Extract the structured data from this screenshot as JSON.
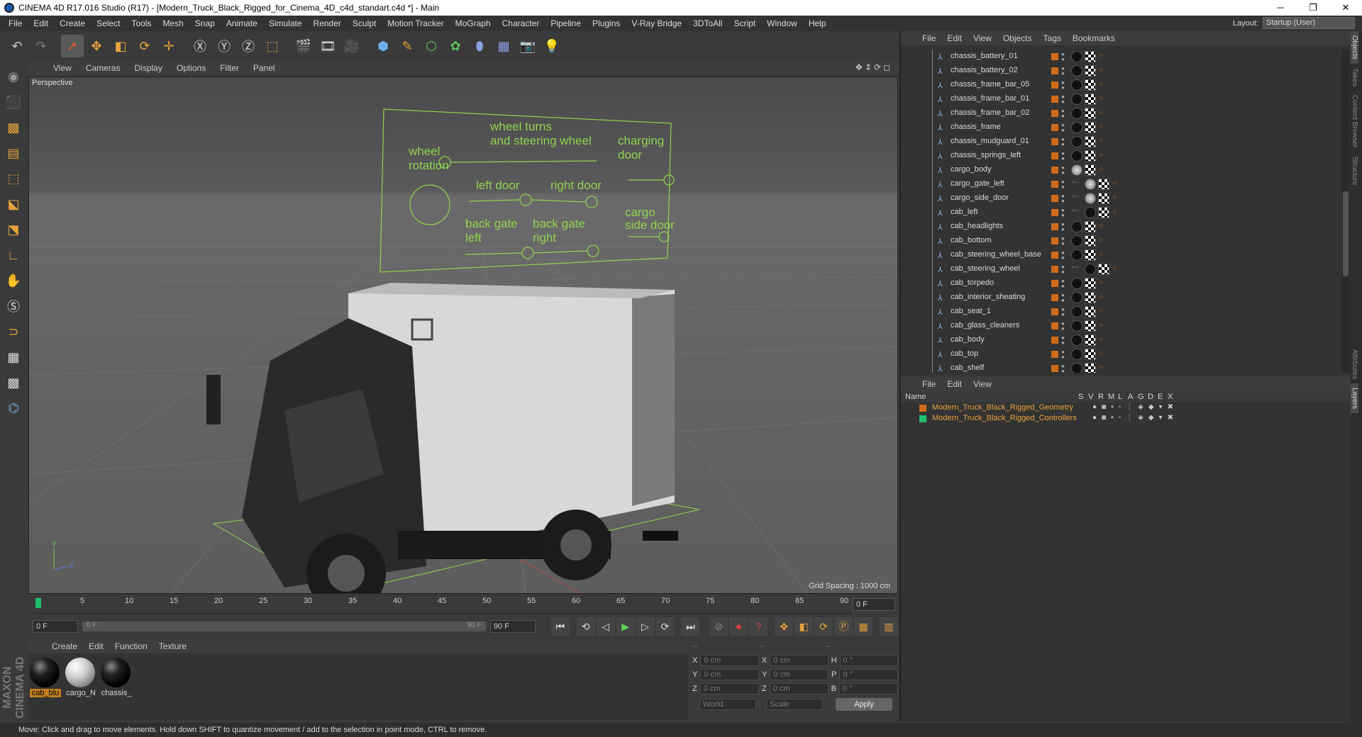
{
  "window": {
    "title": "CINEMA 4D R17.016 Studio (R17) - [Modern_Truck_Black_Rigged_for_Cinema_4D_c4d_standart.c4d *] - Main",
    "minimize": "─",
    "restore": "❐",
    "close": "✕"
  },
  "menu": [
    "File",
    "Edit",
    "Create",
    "Select",
    "Tools",
    "Mesh",
    "Snap",
    "Animate",
    "Simulate",
    "Render",
    "Sculpt",
    "Motion Tracker",
    "MoGraph",
    "Character",
    "Pipeline",
    "Plugins",
    "V-Ray Bridge",
    "3DToAll",
    "Script",
    "Window",
    "Help"
  ],
  "layout": {
    "label": "Layout:",
    "value": "Startup (User)"
  },
  "viewport": {
    "menu": [
      "View",
      "Cameras",
      "Display",
      "Options",
      "Filter",
      "Panel"
    ],
    "label": "Perspective",
    "grid_spacing": "Grid Spacing : 1000 cm",
    "hud": {
      "wheel": "wheel\nrotation",
      "turns": "wheel turns\nand steering wheel",
      "charging": "charging\ndoor",
      "left_door": "left door",
      "right_door": "right door",
      "back_left": "back gate\nleft",
      "back_right": "back gate\nright",
      "cargo_side": "cargo\nside door"
    }
  },
  "timeline": {
    "ticks": [
      "0",
      "5",
      "10",
      "15",
      "20",
      "25",
      "30",
      "35",
      "40",
      "45",
      "50",
      "55",
      "60",
      "65",
      "70",
      "75",
      "80",
      "85",
      "90"
    ],
    "current": "0 F"
  },
  "transport": {
    "start": "0 F",
    "slider_left": "0 F",
    "slider_right": "90 F",
    "end": "90 F"
  },
  "materials": {
    "menu": [
      "Create",
      "Edit",
      "Function",
      "Texture"
    ],
    "items": [
      {
        "name": "cab_blu",
        "active": true,
        "white": false
      },
      {
        "name": "cargo_N",
        "active": false,
        "white": true
      },
      {
        "name": "chassis_",
        "active": false,
        "white": false
      }
    ]
  },
  "coords": {
    "rows": [
      {
        "a": "X",
        "av": "0 cm",
        "b": "X",
        "bv": "0 cm",
        "c": "H",
        "cv": "0 °"
      },
      {
        "a": "Y",
        "av": "0 cm",
        "b": "Y",
        "bv": "0 cm",
        "c": "P",
        "cv": "0 °"
      },
      {
        "a": "Z",
        "av": "0 cm",
        "b": "Z",
        "bv": "0 cm",
        "c": "B",
        "cv": "0 °"
      }
    ],
    "world": "World",
    "scale": "Scale",
    "apply": "Apply",
    "dashes": "--"
  },
  "status": "Move: Click and drag to move elements. Hold down SHIFT to quantize movement / add to the selection in point mode, CTRL to remove.",
  "objects": {
    "menu": [
      "File",
      "Edit",
      "View",
      "Objects",
      "Tags",
      "Bookmarks"
    ],
    "items": [
      "chassis_battery_01",
      "chassis_battery_02",
      "chassis_frame_bar_05",
      "chassis_frame_bar_01",
      "chassis_frame_bar_02",
      "chassis_frame",
      "chassis_mudguard_01",
      "chassis_springs_left",
      "cargo_body",
      "cargo_gate_left",
      "cargo_side_door",
      "cab_left",
      "cab_headlights",
      "cab_bottom",
      "cab_steering_wheel_base",
      "cab_steering_wheel",
      "cab_torpedo",
      "cab_interior_sheating",
      "cab_seat_1",
      "cab_glass_cleaners",
      "cab_body",
      "cab_top",
      "cab_shelf"
    ]
  },
  "layers": {
    "menu": [
      "File",
      "Edit",
      "View"
    ],
    "headers": [
      "Name",
      "S",
      "V",
      "R",
      "M",
      "L",
      "A",
      "G",
      "D",
      "E",
      "X"
    ],
    "items": [
      {
        "name": "Modern_Truck_Black_Rigged_Geometry",
        "color": "#d06b1a"
      },
      {
        "name": "Modern_Truck_Black_Rigged_Controllers",
        "color": "#20c070"
      }
    ]
  },
  "sidetabs": [
    "Objects",
    "Takes",
    "Content Browser",
    "Structure",
    "Attributes",
    "Layers"
  ],
  "brand": "MAXON CINEMA 4D"
}
